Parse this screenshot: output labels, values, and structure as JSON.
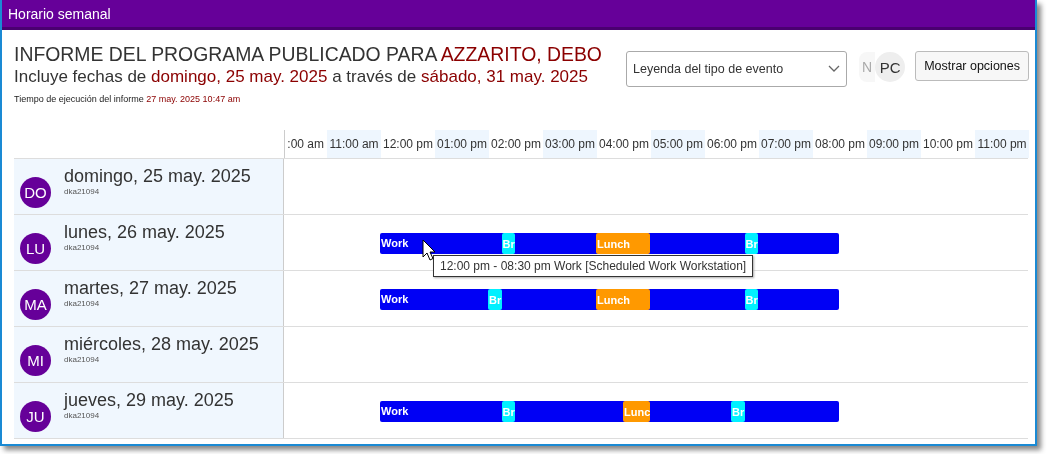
{
  "window": {
    "title": "Horario semanal"
  },
  "header": {
    "title_prefix": "INFORME DEL PROGRAMA PUBLICADO PARA",
    "title_name": "AZZARITO, DEBO",
    "range_prefix": "Incluye fechas de",
    "range_start": "domingo, 25 may. 2025",
    "range_middle": "a través de",
    "range_end": "sábado, 31 may. 2025",
    "run_label": "Tiempo de ejecución del informe",
    "run_time": "27 may. 2025 10:47 am"
  },
  "legend_dropdown": {
    "value": "Leyenda del tipo de evento"
  },
  "avatars": [
    {
      "initials": "N",
      "faded": true
    },
    {
      "initials": "PC",
      "faded": false
    }
  ],
  "options_button": "Mostrar opciones",
  "hours": [
    ":00 am",
    "11:00 am",
    "12:00 pm",
    "01:00 pm",
    "02:00 pm",
    "03:00 pm",
    "04:00 pm",
    "05:00 pm",
    "06:00 pm",
    "07:00 pm",
    "08:00 pm",
    "09:00 pm",
    "10:00 pm",
    "11:00 pm"
  ],
  "days": [
    {
      "initials": "DO",
      "date": "domingo, 25 may. 2025",
      "code": "dka21094"
    },
    {
      "initials": "LU",
      "date": "lunes, 26 may. 2025",
      "code": "dka21094",
      "shift": {
        "label": "Work",
        "events": [
          {
            "kind": "break",
            "label": "Br"
          },
          {
            "kind": "lunch",
            "label": "Lunch"
          },
          {
            "kind": "break",
            "label": "Br"
          }
        ]
      },
      "tooltip": "12:00 pm - 08:30 pm Work [Scheduled Work Workstation]"
    },
    {
      "initials": "MA",
      "date": "martes, 27 may. 2025",
      "code": "dka21094",
      "shift": {
        "label": "Work",
        "events": [
          {
            "kind": "break",
            "label": "Br"
          },
          {
            "kind": "lunch",
            "label": "Lunch"
          },
          {
            "kind": "break",
            "label": "Br"
          }
        ]
      }
    },
    {
      "initials": "MI",
      "date": "miércoles, 28 may. 2025",
      "code": "dka21094"
    },
    {
      "initials": "JU",
      "date": "jueves, 29 may. 2025",
      "code": "dka21094",
      "shift": {
        "label": "Work",
        "events": [
          {
            "kind": "break",
            "label": "Br"
          },
          {
            "kind": "lunch",
            "label": "Lunc"
          },
          {
            "kind": "break",
            "label": "Br"
          }
        ]
      }
    }
  ]
}
